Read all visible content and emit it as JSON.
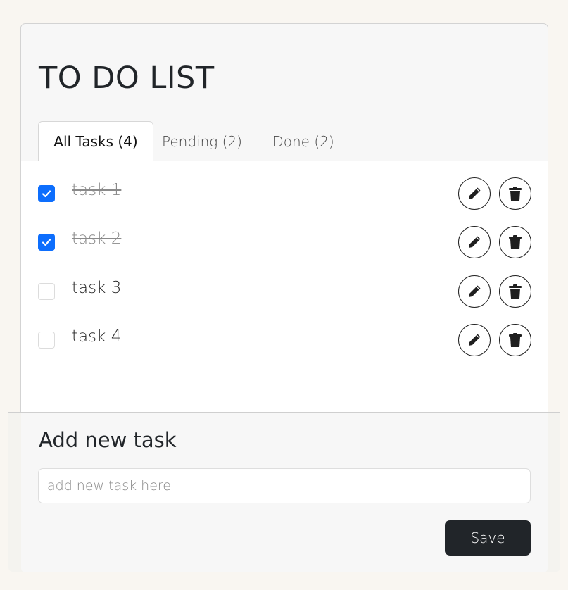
{
  "title": "TO DO LIST",
  "tabs": [
    {
      "label": "All Tasks (4)",
      "active": true
    },
    {
      "label": "Pending (2)",
      "active": false
    },
    {
      "label": "Done (2)",
      "active": false
    }
  ],
  "tasks": [
    {
      "label": "task 1",
      "done": true
    },
    {
      "label": "task 2",
      "done": true
    },
    {
      "label": "task 3",
      "done": false
    },
    {
      "label": "task 4",
      "done": false
    }
  ],
  "add_task": {
    "heading": "Add new task",
    "placeholder": "add new task here",
    "value": "",
    "save_label": "Save"
  },
  "icons": {
    "check": "check-icon",
    "edit": "pencil-icon",
    "delete": "trash-icon"
  },
  "colors": {
    "accent": "#0d6efd",
    "dark": "#212529",
    "done_text": "#8a8a8a"
  }
}
